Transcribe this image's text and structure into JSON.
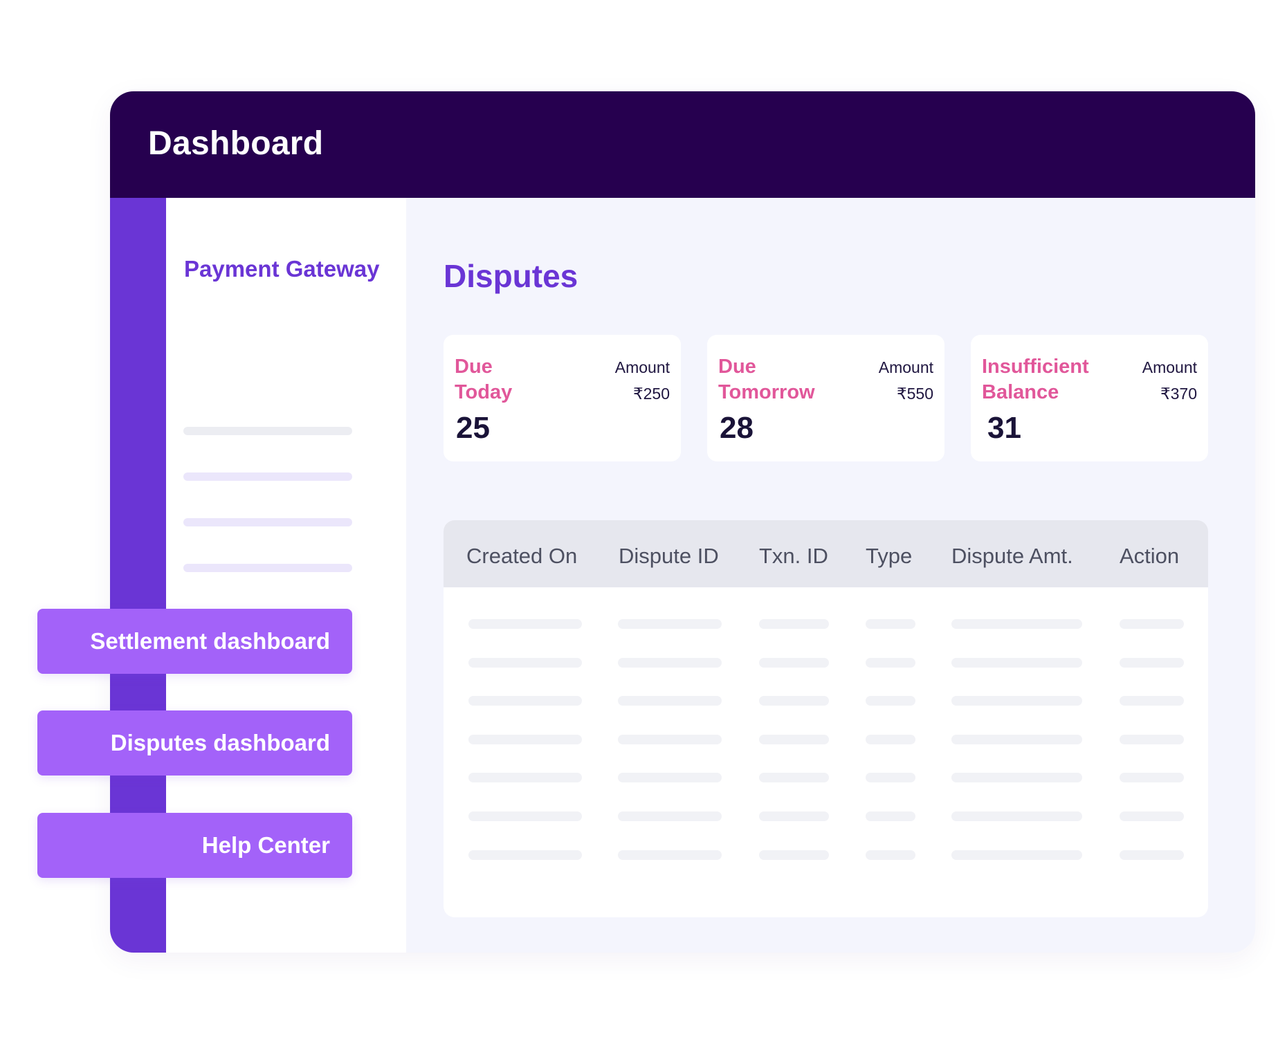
{
  "header": {
    "title": "Dashboard"
  },
  "sidebar": {
    "title": "Payment Gateway"
  },
  "main": {
    "title": "Disputes"
  },
  "cards": [
    {
      "label_line1": "Due",
      "label_line2": "Today",
      "amount_label": "Amount",
      "amount_value": "₹250",
      "count": "25"
    },
    {
      "label_line1": "Due",
      "label_line2": "Tomorrow",
      "amount_label": "Amount",
      "amount_value": "₹550",
      "count": "28"
    },
    {
      "label_line1": "Insufficient",
      "label_line2": "Balance",
      "amount_label": "Amount",
      "amount_value": "₹370",
      "count": "31"
    }
  ],
  "table": {
    "columns": [
      "Created On",
      "Dispute ID",
      "Txn. ID",
      "Type",
      "Dispute Amt.",
      "Action"
    ]
  },
  "floating_buttons": [
    "Settlement dashboard",
    "Disputes dashboard",
    "Help Center"
  ],
  "colors": {
    "header_bg": "#26004f",
    "rail": "#6a35d5",
    "accent_purple": "#6a35d5",
    "accent_pink": "#e1579a",
    "button_bg": "#a362f9"
  }
}
